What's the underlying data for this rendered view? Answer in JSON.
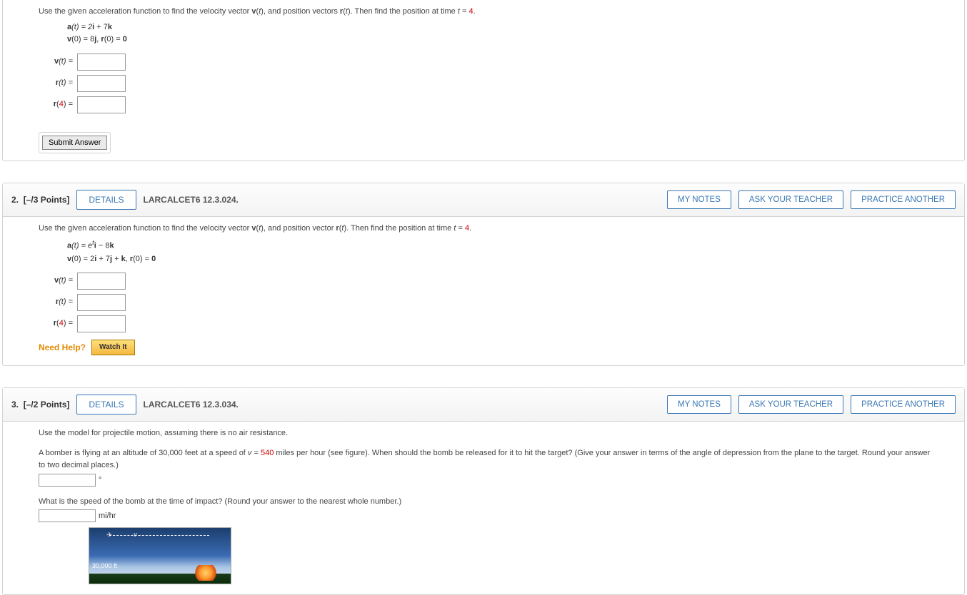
{
  "buttons": {
    "details": "DETAILS",
    "mynotes": "MY NOTES",
    "askteacher": "ASK YOUR TEACHER",
    "practice": "PRACTICE ANOTHER",
    "submit": "Submit Answer",
    "watchit": "Watch It"
  },
  "needhelp_label": "Need Help?",
  "q1": {
    "prompt_pre": "Use the given acceleration function to find the velocity vector ",
    "prompt_mid1": "(",
    "prompt_t1": "t",
    "prompt_mid1b": "), and position vectors ",
    "prompt_mid2": "(",
    "prompt_t2": "t",
    "prompt_mid2b": "). Then find the position at time ",
    "prompt_tvar": "t",
    "prompt_eq": " = ",
    "prompt_val": "4",
    "prompt_end": ".",
    "a_label": "a",
    "v_label": "v",
    "r_label": "r",
    "i_lab": "i",
    "j_lab": "j",
    "k_lab": "k",
    "zero_lab": "0",
    "line1_text": "(t) = 2",
    "line1_text2": " + 7",
    "line2_pre": "(0) = 8",
    "line2_mid": ", ",
    "line2_r0": "(0) = ",
    "ans1_label_v": "v",
    "ans1_label_t": "(t)  =",
    "ans2_label_r": "r",
    "ans2_label_t": "(t)  =",
    "ans3_label_r": "r",
    "ans3_label_4": "(",
    "ans3_4": "4",
    "ans3_close": ")  ="
  },
  "q2": {
    "num": "2.",
    "points": "[–/3 Points]",
    "bookref": "LARCALCET6 12.3.024.",
    "prompt_pre": "Use the given acceleration function to find the velocity vector ",
    "prompt_mid1b": "), and position vector ",
    "prompt_mid2b": "). Then find the position at time ",
    "line1_a": "a",
    "line1_text": "(t) = e",
    "line1_sup": "t",
    "line1_dash": " − 8",
    "line2_v": "v",
    "line2_text": "(0) = 2",
    "line2_plus1": " + 7",
    "line2_plus2": " + ",
    "line2_comma": ",  ",
    "line2_r": "r",
    "line2_r0": "(0) = "
  },
  "q3": {
    "num": "3.",
    "points": "[–/2 Points]",
    "bookref": "LARCALCET6 12.3.034.",
    "line1": "Use the model for projectile motion, assuming there is no air resistance.",
    "line2a": "A bomber is flying at an altitude of 30,000 feet at a speed of  ",
    "line2_v": "v",
    "line2_eq": " = ",
    "line2_val": "540",
    "line2b": "  miles per hour (see figure). When should the bomb be released for it to hit the target? (Give your answer in terms of the angle of depression from the plane to the target. Round your answer to two decimal places.)",
    "deg": "°",
    "line3": "What is the speed of the bomb at the time of impact? (Round your answer to the nearest whole number.)",
    "unit2": "mi/hr",
    "fig_alt": "30,000 ft",
    "fig_v": "v"
  }
}
